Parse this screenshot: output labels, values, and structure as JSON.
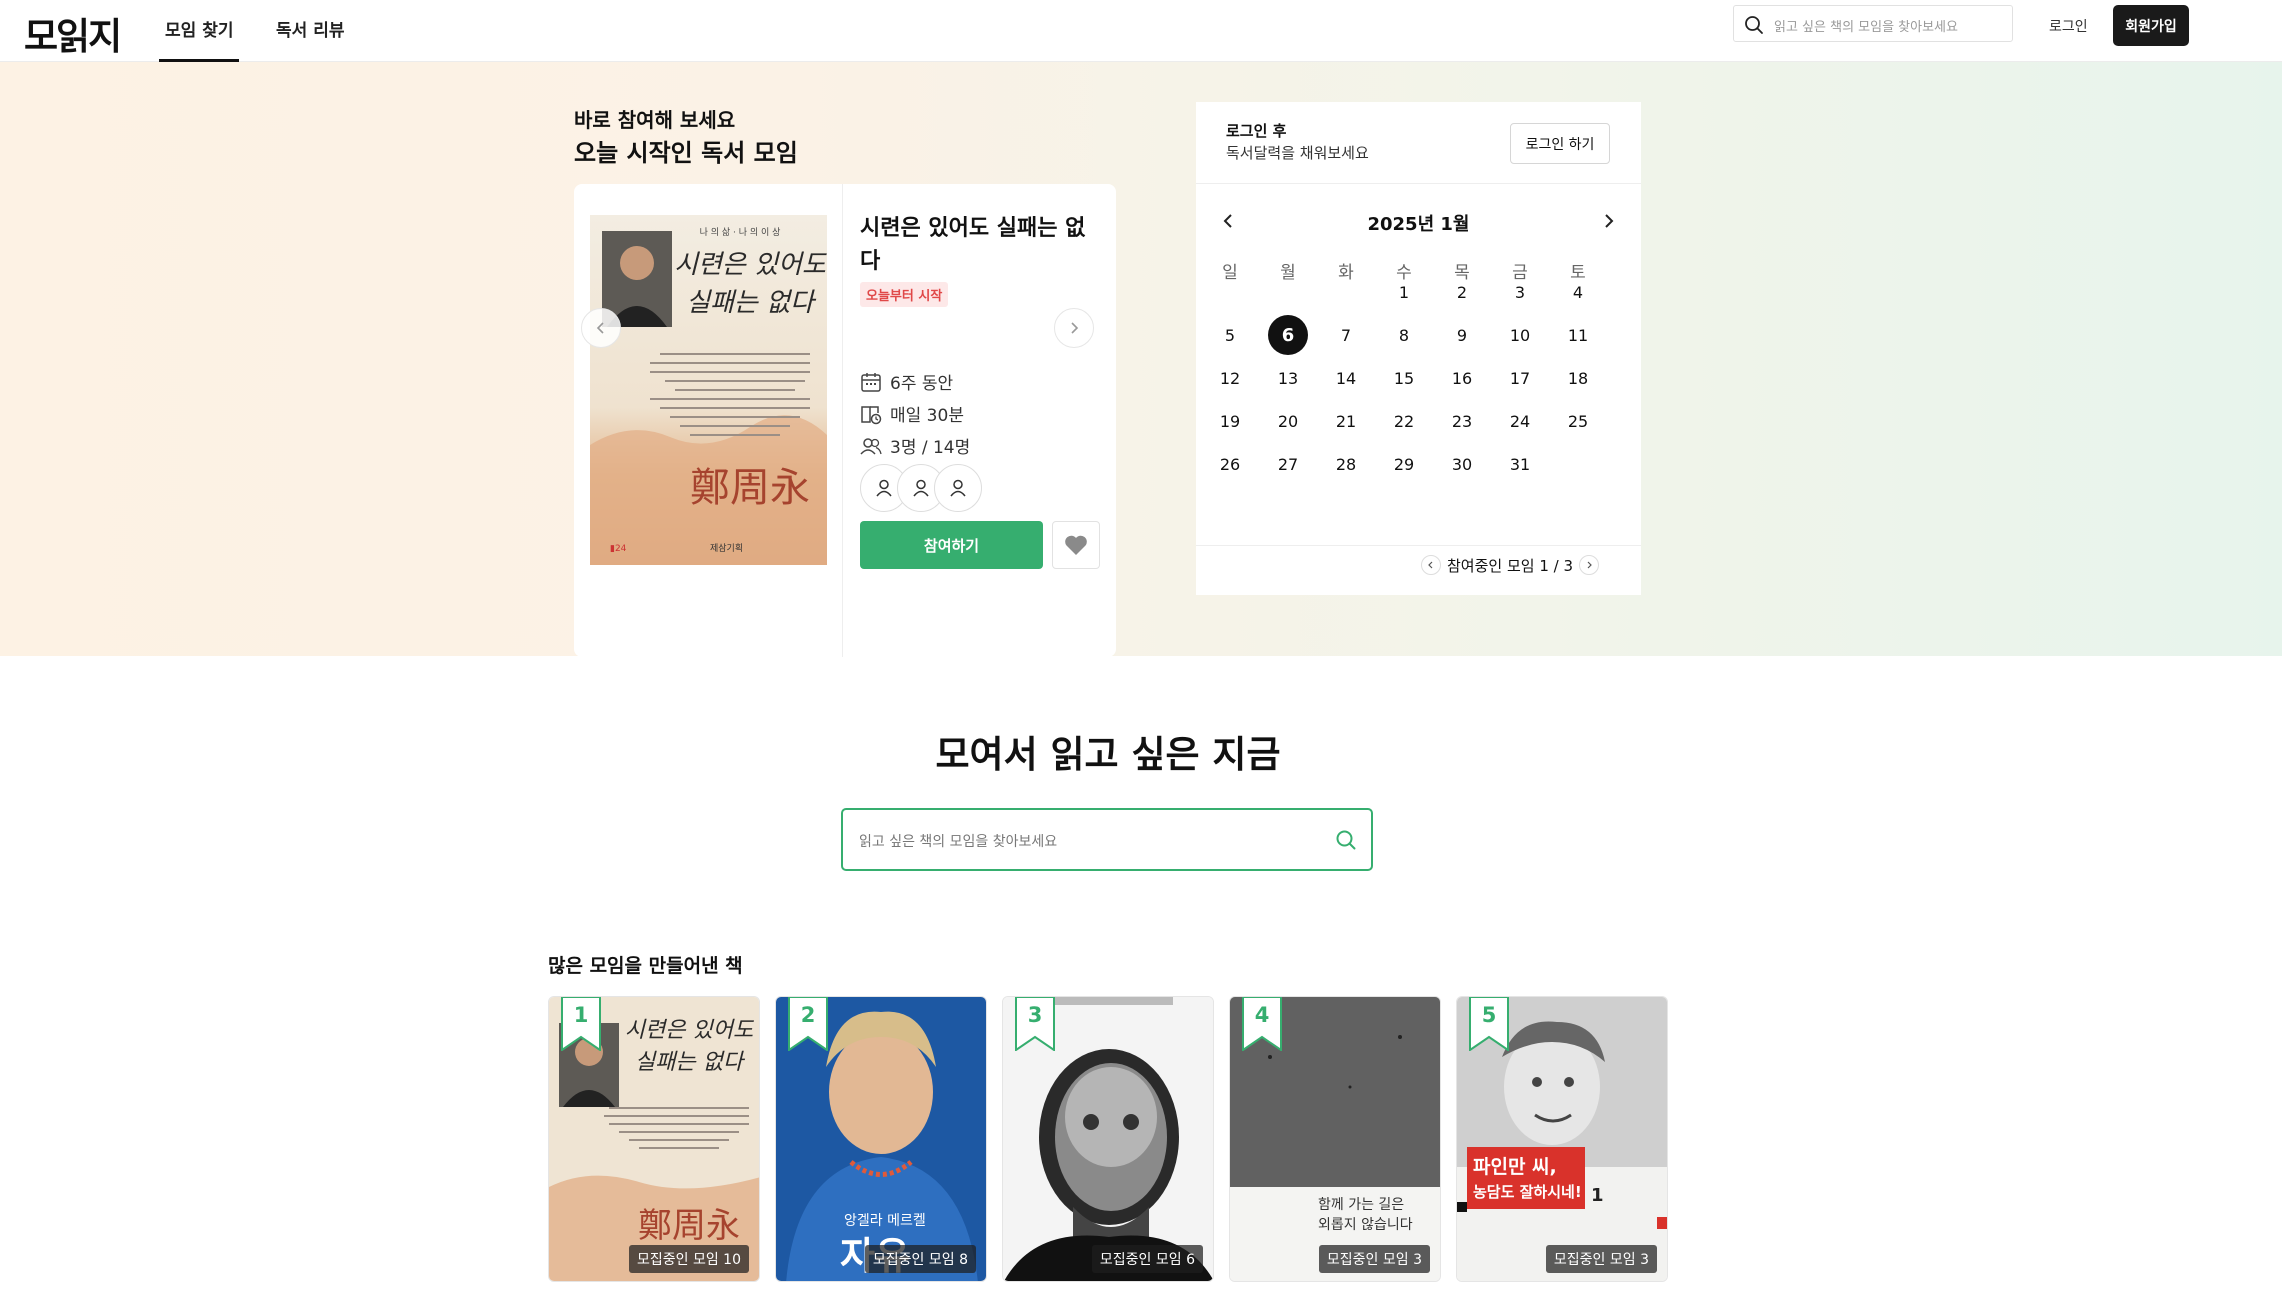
{
  "header": {
    "logo": "모읽지",
    "tabs": [
      "모임 찾기",
      "독서 리뷰"
    ],
    "search_placeholder": "읽고 싶은 책의 모임을 찾아보세요",
    "login_label": "로그인",
    "signup_label": "회원가입"
  },
  "hero": {
    "subtitle": "바로 참여해 보세요",
    "title": "오늘 시작인 독서 모임",
    "meeting": {
      "title": "시련은 있어도 실패는 없다",
      "badge": "오늘부터 시작",
      "duration": "6주 동안",
      "schedule": "매일 30분",
      "members": "3명 / 14명",
      "join_label": "참여하기",
      "cover_text": {
        "series": "나 의 삶 · 나 의 이 상",
        "title_line1": "시련은 있어도",
        "title_line2": "실패는 없다",
        "signature": "鄭周永",
        "publisher": "제삼기획"
      }
    }
  },
  "calendar": {
    "login_title": "로그인 후",
    "login_desc": "독서달력을 채워보세요",
    "login_button": "로그인 하기",
    "month_label": "2025년 1월",
    "weekdays": [
      "일",
      "월",
      "화",
      "수",
      "목",
      "금",
      "토"
    ],
    "first_weekday_index": 3,
    "days_in_month": 31,
    "today": 6,
    "footer": "참여중인 모임 1 / 3"
  },
  "main": {
    "title": "모여서 읽고 싶은 지금",
    "search_placeholder": "읽고 싶은 책의 모임을 찾아보세요"
  },
  "popular": {
    "title": "많은 모임을 만들어낸 책",
    "books": [
      {
        "rank": "1",
        "badge": "모집중인 모임 10"
      },
      {
        "rank": "2",
        "badge": "모집중인 모임 8",
        "cover_text": "앙겔라 메르켈 자유"
      },
      {
        "rank": "3",
        "badge": "모집중인 모임 6"
      },
      {
        "rank": "4",
        "badge": "모집중인 모임 3",
        "cover_text": "함께 가는 길은 외롭지 않습니다"
      },
      {
        "rank": "5",
        "badge": "모집중인 모임 3",
        "cover_text": "파인만 씨, 농담도 잘하시네!"
      }
    ]
  },
  "colors": {
    "accent": "#36ae6f",
    "badge_red": "#e04848",
    "dark": "#1a1a1a"
  }
}
